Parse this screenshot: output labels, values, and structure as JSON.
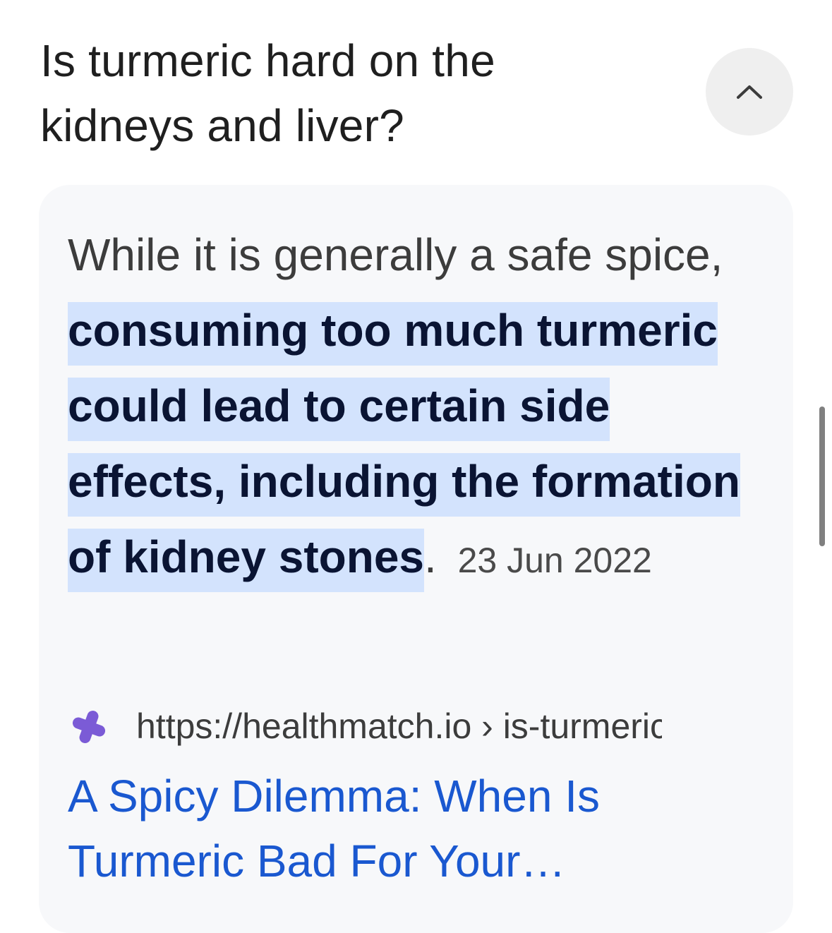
{
  "question": "Is turmeric hard on the kidneys and liver?",
  "collapse_icon": "chevron-up-icon",
  "answer": {
    "intro": "While it is generally a safe spice, ",
    "highlight": "consuming too much turmeric could lead to certain side effects, including the formation of kidney stones",
    "end": ".",
    "date": "23 Jun 2022"
  },
  "source": {
    "favicon": "healthmatch-logo-icon",
    "url": "https://healthmatch.io › is-turmeric",
    "title": "A Spicy Dilemma: When Is Turmeric Bad For Your…"
  },
  "colors": {
    "highlight_bg": "#d3e3fd",
    "link": "#1a58d0",
    "favicon": "#7b5bd6"
  }
}
